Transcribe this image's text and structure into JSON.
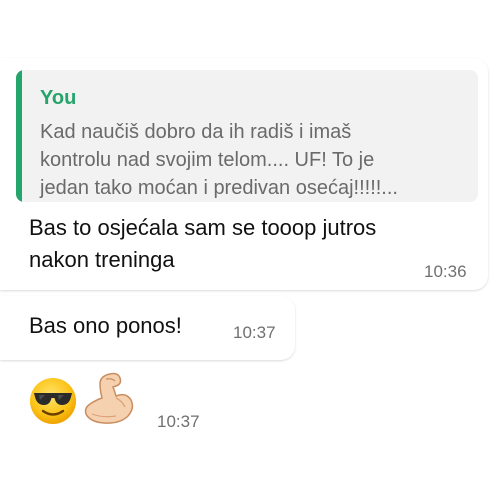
{
  "chat": {
    "quoted_reply": {
      "author": "You",
      "text": "Kad naučiš dobro da ih radiš i imaš\nkontrolu nad svojim telom.... UF! To je\njedan tako moćan i predivan osećaj!!!!!..."
    },
    "messages": [
      {
        "text": "Bas to  osjećala sam se tooop jutros\nnakon treninga",
        "time": "10:36"
      },
      {
        "text": "Bas ono ponos!",
        "time": "10:37"
      },
      {
        "emojis": [
          "smiling-face-with-sunglasses-icon",
          "flexed-biceps-icon"
        ],
        "time": "10:37"
      }
    ]
  },
  "colors": {
    "quote_accent": "#25a46b",
    "quote_background": "#f2f2f2",
    "bubble_background": "#ffffff"
  }
}
